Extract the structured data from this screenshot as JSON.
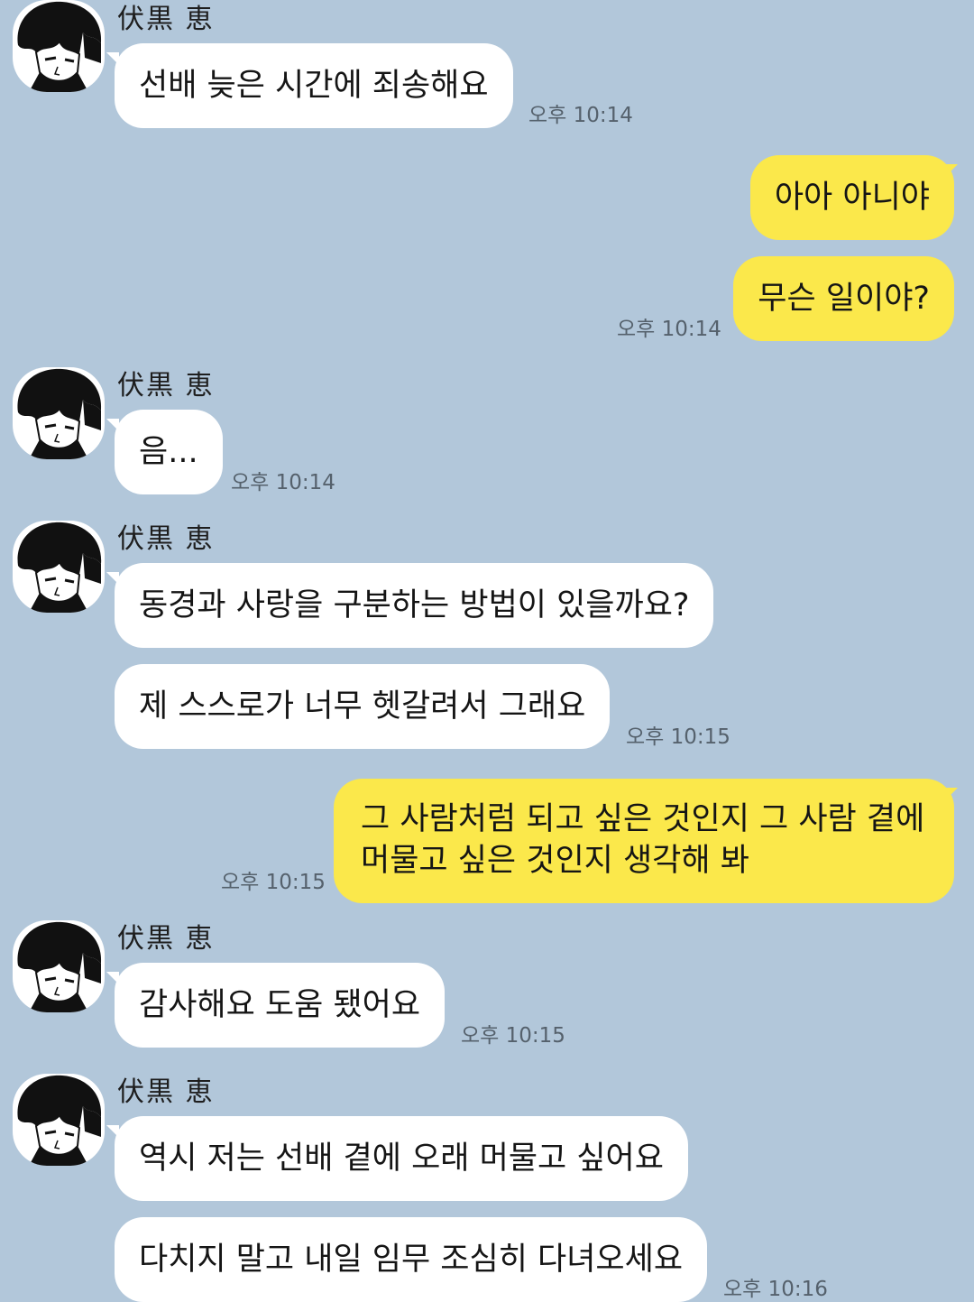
{
  "contact": {
    "name": "伏黒 恵"
  },
  "messages": {
    "m1": "선배 늦은 시간에 죄송해요",
    "m2": "아아 아니야",
    "m3": "무슨 일이야?",
    "m4": "음...",
    "m5": "동경과 사랑을 구분하는 방법이 있을까요?",
    "m6": "제 스스로가 너무 헷갈려서 그래요",
    "m7": "그 사람처럼 되고 싶은 것인지 그 사람 곁에 머물고 싶은 것인지 생각해 봐",
    "m8": "감사해요 도움 됐어요",
    "m9": "역시 저는 선배 곁에 오래 머물고 싶어요",
    "m10": "다치지 말고 내일 임무 조심히 다녀오세요"
  },
  "times": {
    "t1": "오후 10:14",
    "t2": "오후 10:14",
    "t3": "오후 10:14",
    "t4": "오후 10:15",
    "t5": "오후 10:15",
    "t6": "오후 10:15",
    "t7": "오후 10:16"
  },
  "colors": {
    "background": "#b2c7da",
    "incoming_bubble": "#ffffff",
    "outgoing_bubble": "#fbe84b"
  },
  "icons": {
    "avatar": "manga-character-portrait"
  }
}
